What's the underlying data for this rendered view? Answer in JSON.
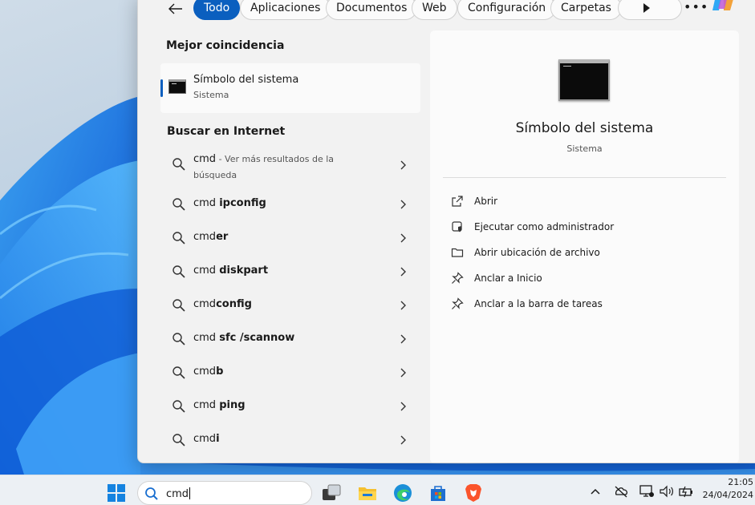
{
  "filters": {
    "tabs": [
      "Todo",
      "Aplicaciones",
      "Documentos",
      "Web",
      "Configuración",
      "Carpetas"
    ],
    "active": "Todo"
  },
  "best_match": {
    "heading": "Mejor coincidencia",
    "title": "Símbolo del sistema",
    "subtitle": "Sistema"
  },
  "web": {
    "heading": "Buscar en Internet",
    "first": {
      "query": "cmd",
      "more": " - Ver más resultados de la búsqueda"
    },
    "items": [
      {
        "base": "cmd ",
        "bold": "ipconfig"
      },
      {
        "base": "cmd",
        "bold": "er"
      },
      {
        "base": "cmd ",
        "bold": "diskpart"
      },
      {
        "base": "cmd",
        "bold": "config"
      },
      {
        "base": "cmd ",
        "bold": "sfc /scannow"
      },
      {
        "base": "cmd",
        "bold": "b"
      },
      {
        "base": "cmd ",
        "bold": "ping"
      },
      {
        "base": "cmd",
        "bold": "i"
      }
    ]
  },
  "detail": {
    "title": "Símbolo del sistema",
    "subtitle": "Sistema",
    "actions": [
      {
        "label": "Abrir",
        "icon": "open-external-icon"
      },
      {
        "label": "Ejecutar como administrador",
        "icon": "admin-shield-icon"
      },
      {
        "label": "Abrir ubicación de archivo",
        "icon": "folder-icon"
      },
      {
        "label": "Anclar a Inicio",
        "icon": "pin-icon"
      },
      {
        "label": "Anclar a la barra de tareas",
        "icon": "pin-icon"
      }
    ]
  },
  "taskbar": {
    "search_value": "cmd",
    "time": "21:05",
    "date": "24/04/2024"
  },
  "colors": {
    "accent": "#0b5fbf",
    "panel": "#f2f2f2",
    "taskbar": "#ecf0f4"
  }
}
